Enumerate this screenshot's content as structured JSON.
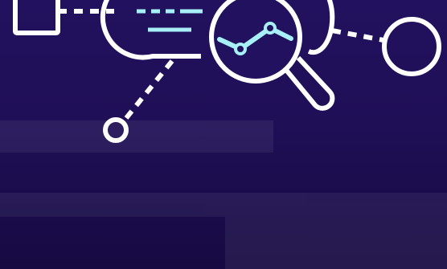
{
  "colors": {
    "background_top": "#22115e",
    "background_bottom": "#170a42",
    "stroke_primary": "#ffffff",
    "stroke_accent": "#a8f0f8"
  },
  "icons": {
    "square_node": "square-node-icon",
    "document_cloud": "document-cloud-icon",
    "magnifier": "magnifying-glass-icon",
    "trend_line": "trend-line-icon",
    "small_circle_node": "circle-node-icon",
    "large_circle_node": "circle-node-icon"
  }
}
